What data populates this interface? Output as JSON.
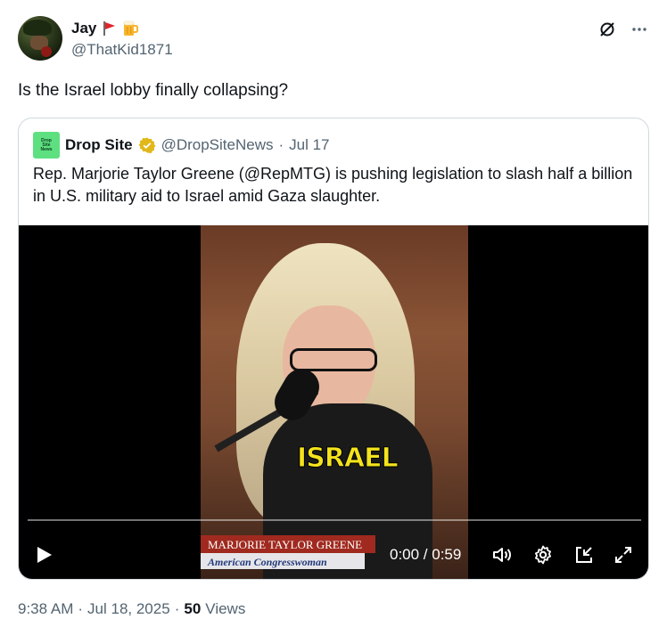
{
  "author": {
    "display_name": "Jay",
    "handle": "@ThatKid1871",
    "emoji_icons": [
      "red-flag-icon",
      "beer-mug-icon"
    ]
  },
  "tweet": {
    "text": "Is the Israel lobby finally collapsing?"
  },
  "quoted": {
    "name": "Drop Site",
    "logo_text": [
      "Drop",
      "Site",
      "News"
    ],
    "handle": "@DropSiteNews",
    "separator": "·",
    "date": "Jul 17",
    "text": "Rep. Marjorie Taylor Greene (@RepMTG) is pushing legislation to slash half a billion in U.S. military aid to Israel amid Gaza slaughter.",
    "video": {
      "caption_word": "ISRAEL",
      "lower_third_name": "MARJORIE TAYLOR GREENE",
      "lower_third_title": "American Congresswoman",
      "time_display": "0:00 / 0:59",
      "progress": 0
    }
  },
  "footer": {
    "time": "9:38 AM",
    "sep1": "·",
    "date": "Jul 18, 2025",
    "sep2": "·",
    "views_count": "50",
    "views_label": "Views"
  },
  "colors": {
    "text": "#0f1419",
    "muted": "#536471",
    "border": "#cfd9de",
    "verified_gold": "#e2b719",
    "logo_green": "#5ee081"
  }
}
